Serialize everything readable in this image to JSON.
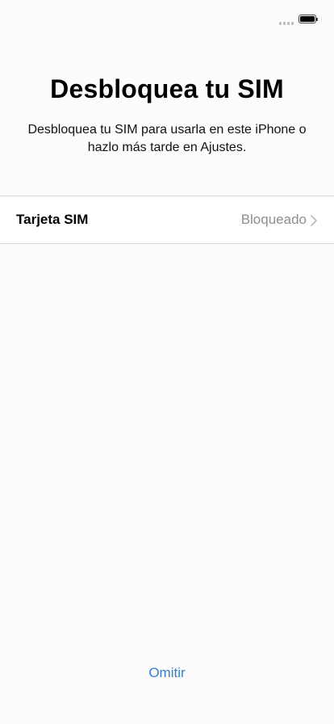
{
  "status_bar": {
    "battery_level": 1.0,
    "icons": [
      "signal-icon",
      "battery-icon"
    ]
  },
  "header": {
    "title": "Desbloquea tu SIM",
    "subtitle": "Desbloquea tu SIM para usarla en este iPhone o hazlo más tarde en Ajustes."
  },
  "sim_row": {
    "label": "Tarjeta SIM",
    "value": "Bloqueado",
    "icon": "chevron-right-icon"
  },
  "footer": {
    "skip_label": "Omitir"
  },
  "colors": {
    "accent": "#2f7fd7",
    "secondary_text": "#8e8e93",
    "separator": "#dcdcdf",
    "background": "#fcfcfd"
  }
}
